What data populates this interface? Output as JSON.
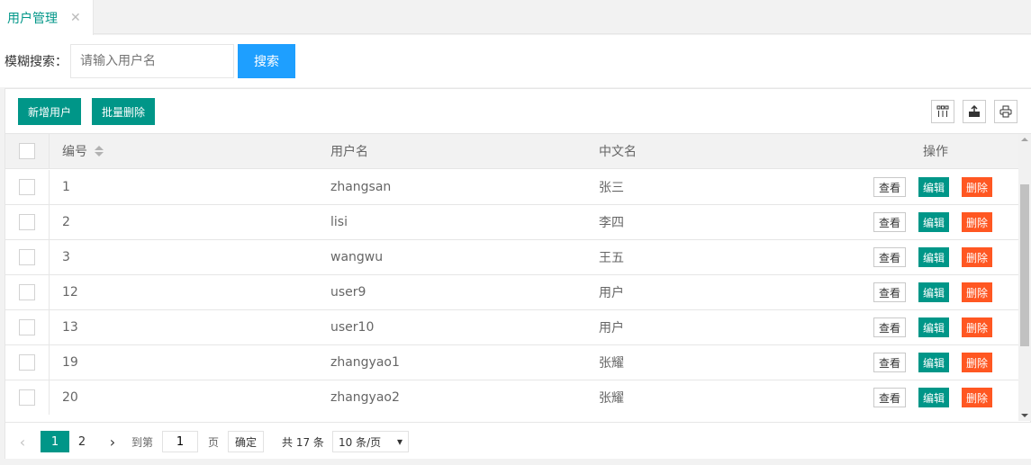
{
  "tabs": [
    {
      "label": "用户管理",
      "close": "✕"
    }
  ],
  "search": {
    "label": "模糊搜索：",
    "placeholder": "请输入用户名",
    "value": "",
    "button_label": "搜索"
  },
  "toolbar": {
    "add_label": "新增用户",
    "batch_delete_label": "批量删除",
    "icons": [
      "columns-icon",
      "export-icon",
      "print-icon"
    ]
  },
  "table": {
    "columns": [
      "编号",
      "用户名",
      "中文名",
      "操作"
    ],
    "rows": [
      {
        "id": "1",
        "username": "zhangsan",
        "cn_name": "张三"
      },
      {
        "id": "2",
        "username": "lisi",
        "cn_name": "李四"
      },
      {
        "id": "3",
        "username": "wangwu",
        "cn_name": "王五"
      },
      {
        "id": "12",
        "username": "user9",
        "cn_name": "用户"
      },
      {
        "id": "13",
        "username": "user10",
        "cn_name": "用户"
      },
      {
        "id": "19",
        "username": "zhangyao1",
        "cn_name": "张耀"
      },
      {
        "id": "20",
        "username": "zhangyao2",
        "cn_name": "张耀"
      }
    ],
    "actions": {
      "view": "查看",
      "edit": "编辑",
      "delete": "删除"
    }
  },
  "pager": {
    "pages": [
      "1",
      "2"
    ],
    "current": "1",
    "goto_prefix": "到第",
    "goto_value": "1",
    "goto_suffix": "页",
    "confirm_label": "确定",
    "total_text": "共 17 条",
    "page_size": "10 条/页"
  },
  "colors": {
    "primary": "#009688",
    "search_blue": "#1e9fff",
    "danger": "#ff5722"
  }
}
